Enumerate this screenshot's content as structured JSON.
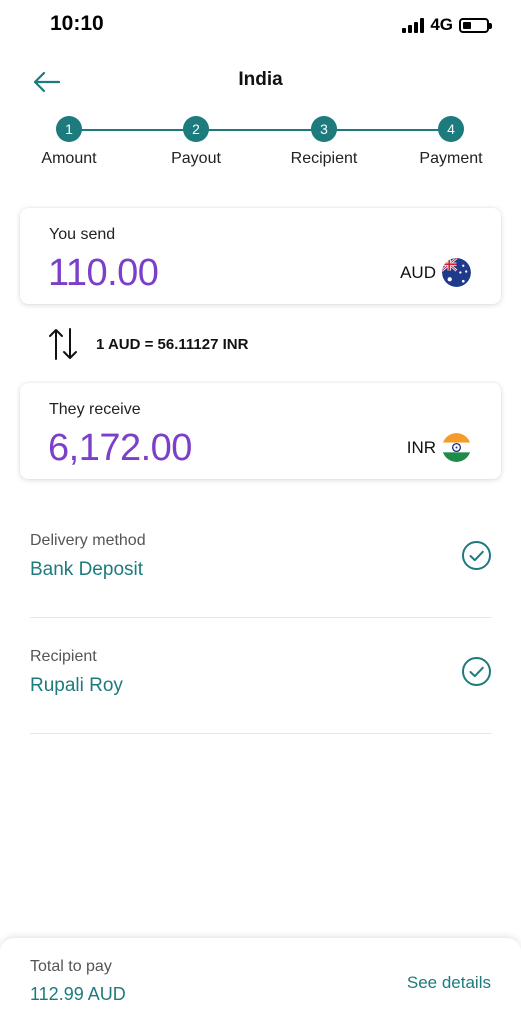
{
  "status_bar": {
    "time": "10:10",
    "network": "4G"
  },
  "header": {
    "title": "India",
    "back_icon": "arrow-left-icon"
  },
  "stepper": {
    "steps": [
      {
        "number": "1",
        "label": "Amount"
      },
      {
        "number": "2",
        "label": "Payout"
      },
      {
        "number": "3",
        "label": "Recipient"
      },
      {
        "number": "4",
        "label": "Payment"
      }
    ]
  },
  "send": {
    "label": "You send",
    "amount": "110.00",
    "currency": "AUD",
    "flag_icon": "australia-flag-icon"
  },
  "rate": {
    "text": "1 AUD = 56.11127 INR",
    "icon": "swap-vertical-icon"
  },
  "receive": {
    "label": "They receive",
    "amount": "6,172.00",
    "currency": "INR",
    "flag_icon": "india-flag-icon"
  },
  "delivery": {
    "label": "Delivery method",
    "value": "Bank Deposit",
    "icon": "check-circle-icon"
  },
  "recipient": {
    "label": "Recipient",
    "value": "Rupali Roy",
    "icon": "check-circle-icon"
  },
  "footer": {
    "total_label": "Total to pay",
    "total_value": "112.99 AUD",
    "details_link": "See details"
  },
  "colors": {
    "accent": "#1d7b7e",
    "amount": "#7b3fc9",
    "text": "#111111",
    "muted": "#555555"
  }
}
